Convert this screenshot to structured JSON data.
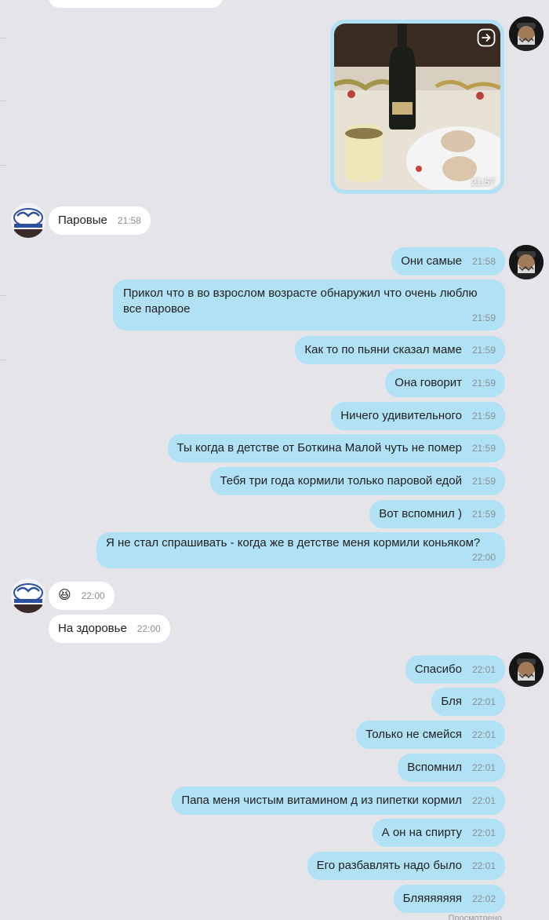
{
  "chat": {
    "photo_message": {
      "time": "21:57"
    },
    "messages": [
      {
        "text": "Паровые",
        "time": "21:58"
      },
      {
        "text": "Они самые",
        "time": "21:58"
      },
      {
        "text": "Прикол что в во взрослом возрасте обнаружил что очень люблю все паровое",
        "time": "21:59"
      },
      {
        "text": "Как то по пьяни сказал маме",
        "time": "21:59"
      },
      {
        "text": "Она говорит",
        "time": "21:59"
      },
      {
        "text": "Ничего удивительного",
        "time": "21:59"
      },
      {
        "text": "Ты когда в детстве от Боткина Малой чуть не помер",
        "time": "21:59"
      },
      {
        "text": "Тебя три года кормили только паровой едой",
        "time": "21:59"
      },
      {
        "text": "Вот вспомнил )",
        "time": "21:59"
      },
      {
        "text": "Я не стал спрашивать - когда же в детстве меня кормили коньяком?",
        "time": "22:00"
      },
      {
        "text": "😆",
        "time": "22:00"
      },
      {
        "text": "На здоровье",
        "time": "22:00"
      },
      {
        "text": "Спасибо",
        "time": "22:01"
      },
      {
        "text": "Бля",
        "time": "22:01"
      },
      {
        "text": "Только не смейся",
        "time": "22:01"
      },
      {
        "text": "Вспомнил",
        "time": "22:01"
      },
      {
        "text": "Папа меня чистым витамином д из пипетки кормил",
        "time": "22:01"
      },
      {
        "text": "А он на спирту",
        "time": "22:01"
      },
      {
        "text": "Его разбавлять надо было",
        "time": "22:01"
      },
      {
        "text": "Бляяяяяяя",
        "time": "22:02"
      }
    ],
    "bottom_hint": "Просмотрено"
  },
  "colors": {
    "background": "#e5e5e9",
    "outgoing_bubble": "#b1e1f5",
    "incoming_bubble": "#ffffff",
    "timestamp": "#8b8f94"
  }
}
